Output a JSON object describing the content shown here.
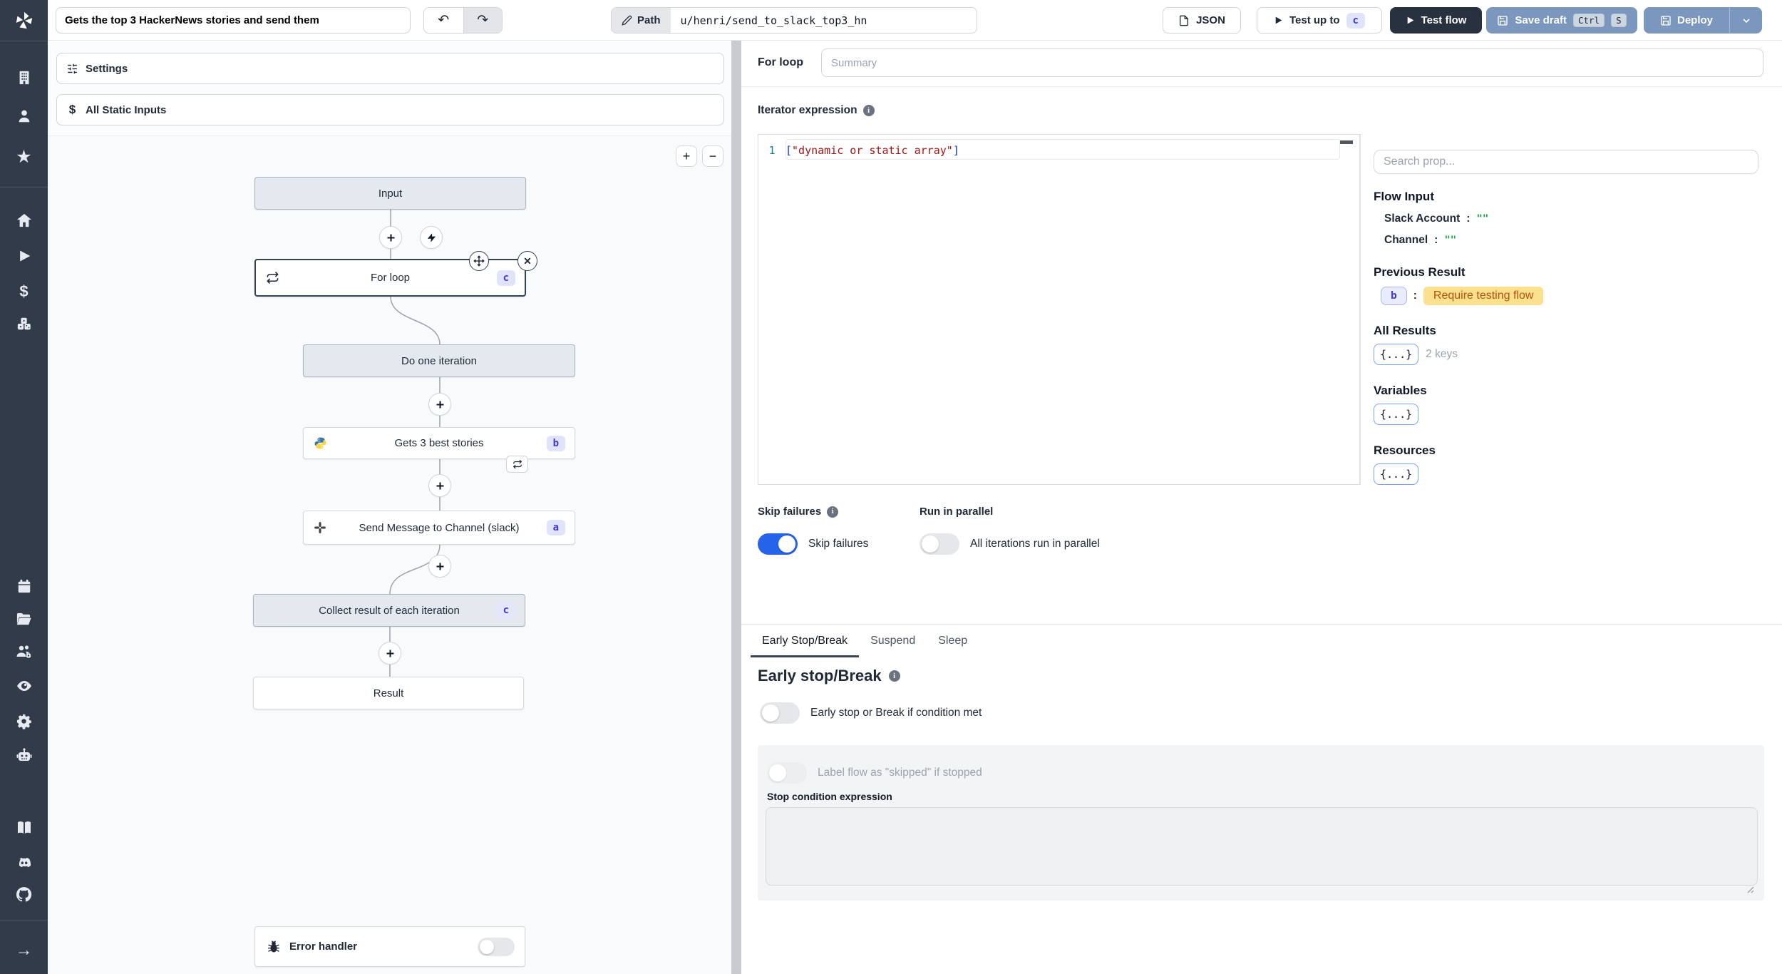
{
  "topbar": {
    "flow_title": "Gets the top 3 HackerNews stories and send them",
    "undo": "↶",
    "redo": "↷",
    "path_label": "Path",
    "path_value": "u/henri/send_to_slack_top3_hn",
    "json_button": "JSON",
    "test_up_to_label": "Test up to",
    "test_up_to_badge": "c",
    "test_flow_label": "Test flow",
    "save_draft_label": "Save draft",
    "save_kbd": [
      "Ctrl",
      "S"
    ],
    "deploy_label": "Deploy"
  },
  "sidebar": {
    "icons": [
      "windmill-logo",
      "building",
      "user",
      "star",
      "home",
      "play",
      "dollar",
      "resources",
      "calendar",
      "folder-open",
      "users-gear",
      "eye",
      "gear",
      "robot",
      "book",
      "discord",
      "github",
      "arrow-right"
    ]
  },
  "flow_panel": {
    "settings_label": "Settings",
    "static_inputs_label": "All Static Inputs",
    "zoom_in": "+",
    "zoom_out": "−",
    "nodes": {
      "input_label": "Input",
      "for_loop": {
        "label": "For loop",
        "badge": "c"
      },
      "do_one_iteration": "Do one iteration",
      "step_b": {
        "label": "Gets 3 best stories",
        "badge": "b"
      },
      "step_a": {
        "label": "Send Message to Channel (slack)",
        "badge": "a"
      },
      "collect": {
        "label": "Collect result of each iteration",
        "badge": "c"
      },
      "result_label": "Result",
      "error_handler_label": "Error handler"
    },
    "delete_glyph": "✕"
  },
  "inspector": {
    "node_label": "For loop",
    "summary_placeholder": "Summary",
    "iterator_label": "Iterator expression",
    "editor": {
      "line_number": "1",
      "bracket_open": "[",
      "string_part": "\"dynamic or static array\"",
      "bracket_close": "]"
    },
    "skip_failures_title": "Skip failures",
    "skip_failures_label": "Skip failures",
    "run_in_parallel_title": "Run in parallel",
    "run_in_parallel_label": "All iterations run in parallel",
    "tabs": [
      "Early Stop/Break",
      "Suspend",
      "Sleep"
    ],
    "early_stop": {
      "heading": "Early stop/Break",
      "condition_toggle_label": "Early stop or Break if condition met",
      "skipped_toggle_label": "Label flow as \"skipped\" if stopped",
      "stop_condition_label": "Stop condition expression"
    }
  },
  "props_panel": {
    "search_placeholder": "Search prop...",
    "flow_input_heading": "Flow Input",
    "flow_input_items": [
      {
        "key": "Slack Account",
        "colon": ":",
        "value": "\"\""
      },
      {
        "key": "Channel",
        "colon": ":",
        "value": "\"\""
      }
    ],
    "previous_result_heading": "Previous Result",
    "previous_result_badge": "b",
    "previous_result_colon": ":",
    "previous_result_value": "Require testing flow",
    "all_results_heading": "All Results",
    "all_results_badge": "{...}",
    "all_results_note": "2 keys",
    "variables_heading": "Variables",
    "variables_badge": "{...}",
    "resources_heading": "Resources",
    "resources_badge": "{...}"
  },
  "colors": {
    "accent_blue": "#2563eb",
    "badge_indigo_bg": "#dfe3fc",
    "badge_indigo_text": "#4338ca",
    "amber_highlight_bg": "#fbe08e",
    "amber_highlight_text": "#b45309",
    "string_green": "#16a34a",
    "code_string_red": "#a31515",
    "code_bracket_blue": "#0431fa",
    "sidebar_bg": "#323b49",
    "dark_button_bg": "#28313f",
    "slate_button_bg": "#7b97bd"
  }
}
